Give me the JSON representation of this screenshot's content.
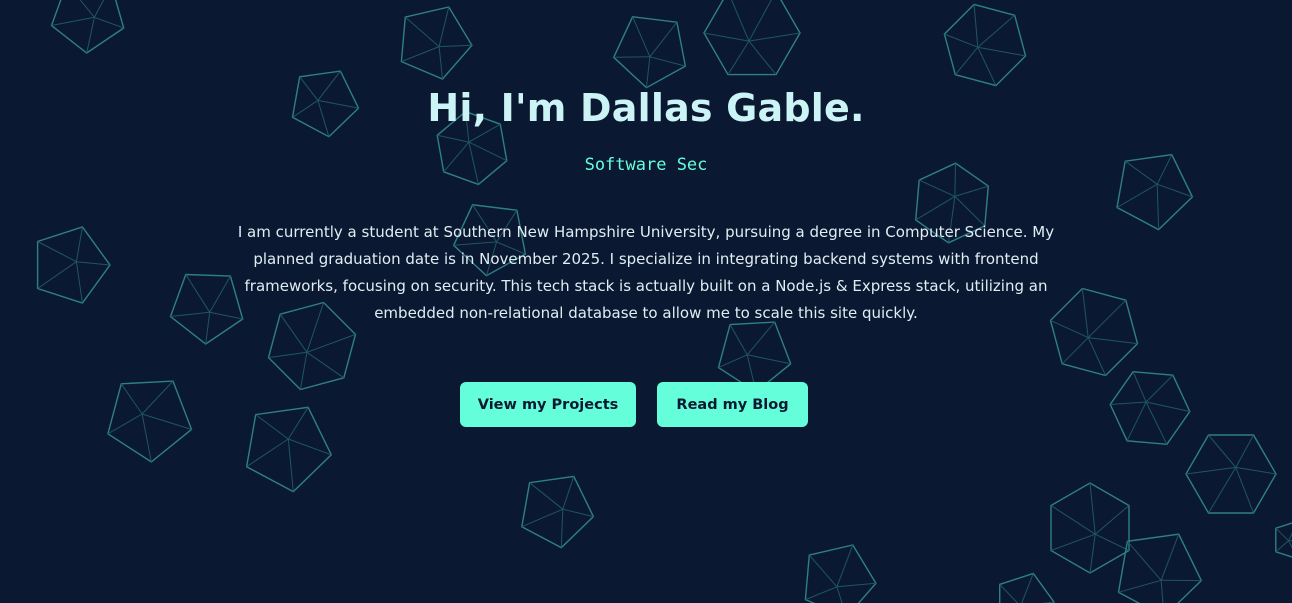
{
  "hero": {
    "title": "Hi, I'm Dallas Gable.",
    "subtitle": "Software Sec",
    "bio": "I am currently a student at Southern New Hampshire University, pursuing a degree in Computer Science. My planned graduation date is in November 2025. I specialize in integrating backend systems with frontend frameworks, focusing on security. This tech stack is actually built on a Node.js & Express stack, utilizing an embedded non-relational database to allow me to scale this site quickly."
  },
  "actions": {
    "projects_label": "View my Projects",
    "blog_label": "Read my Blog"
  },
  "background": {
    "shape_icon": "polyhedron-wireframe-icon",
    "colors": {
      "bg": "#0a1931",
      "outline": "#2f7f86",
      "inner": "#1f5660",
      "accent": "#64ffda",
      "title": "#ccf4f6",
      "text": "#e2ecf3"
    }
  }
}
